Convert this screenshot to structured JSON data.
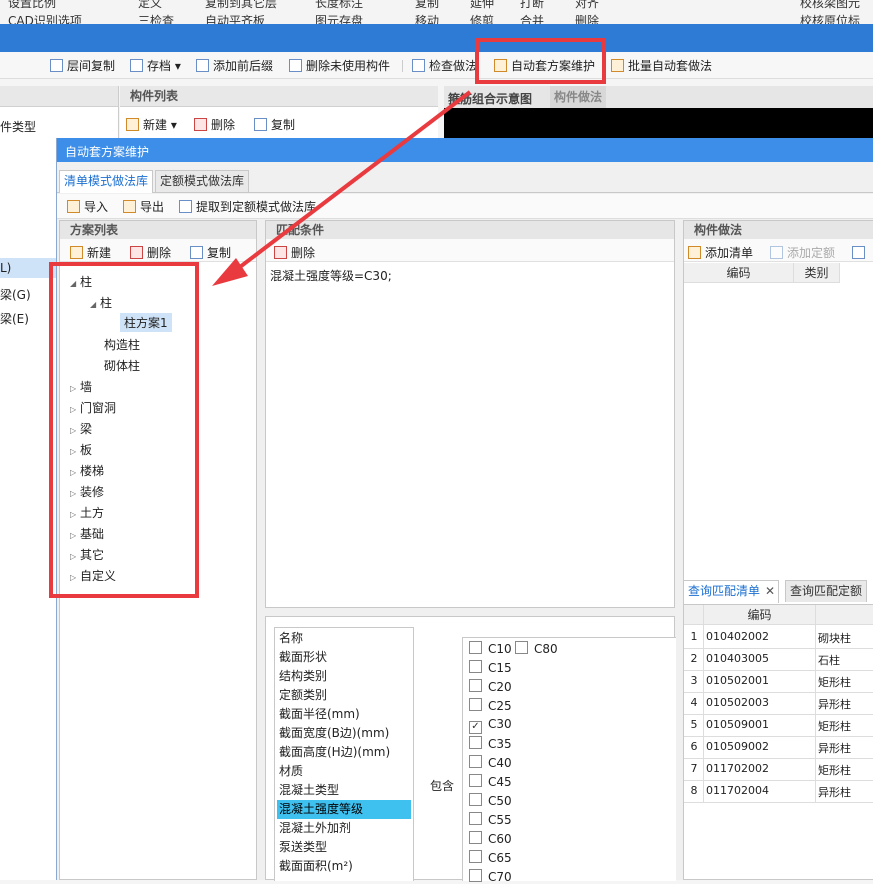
{
  "top_strip": [
    "设置比例",
    "CAD识别选项",
    "定义",
    "复制到其它层",
    "长度标注",
    "复制",
    "延伸",
    "打断",
    "对齐",
    "校核梁图元",
    "三检查",
    "自动平齐板",
    "图元存盘",
    "移动",
    "修剪",
    "合并",
    "删除",
    "校核原位标"
  ],
  "main_toolbar": {
    "floor_copy": "层间复制",
    "save": "存档",
    "add_prefix": "添加前后缀",
    "delete_unused": "删除未使用构件",
    "check_method": "检查做法",
    "auto_maint": "自动套方案维护",
    "batch_auto": "批量自动套做法"
  },
  "left_panel": {
    "type_label": "件类型",
    "items": [
      "L)",
      "梁(G)",
      "梁(E)"
    ]
  },
  "mid_panel": {
    "title": "构件列表",
    "new": "新建",
    "delete": "删除",
    "copy": "复制"
  },
  "right_tabs": [
    "箍筋组合示意图",
    "构件做法"
  ],
  "dialog": {
    "title": "自动套方案维护",
    "tabs": [
      "清单模式做法库",
      "定额模式做法库"
    ],
    "toolbar": {
      "import": "导入",
      "export": "导出",
      "extract": "提取到定额模式做法库"
    },
    "scheme": {
      "title": "方案列表",
      "new": "新建",
      "delete": "删除",
      "copy": "复制",
      "tree": {
        "root": "柱",
        "child": "柱",
        "leaf": "柱方案1",
        "sub1": "构造柱",
        "sub2": "砌体柱",
        "others": [
          "墙",
          "门窗洞",
          "梁",
          "板",
          "楼梯",
          "装修",
          "土方",
          "基础",
          "其它",
          "自定义"
        ]
      }
    },
    "condition": {
      "title": "匹配条件",
      "delete": "删除",
      "text": "混凝土强度等级=C30;"
    },
    "attributes": [
      "名称",
      "截面形状",
      "结构类别",
      "定额类别",
      "截面半径(mm)",
      "截面宽度(B边)(mm)",
      "截面高度(H边)(mm)",
      "材质",
      "混凝土类型",
      "混凝土强度等级",
      "混凝土外加剂",
      "泵送类型",
      "截面面积(m²)"
    ],
    "selected_attribute": "混凝土强度等级",
    "contain_label": "包含",
    "grades": [
      {
        "label": "C10",
        "checked": false
      },
      {
        "label": "C80",
        "checked": false
      },
      {
        "label": "C15",
        "checked": false
      },
      {
        "label": "C20",
        "checked": false
      },
      {
        "label": "C25",
        "checked": false
      },
      {
        "label": "C30",
        "checked": true
      },
      {
        "label": "C35",
        "checked": false
      },
      {
        "label": "C40",
        "checked": false
      },
      {
        "label": "C45",
        "checked": false
      },
      {
        "label": "C50",
        "checked": false
      },
      {
        "label": "C55",
        "checked": false
      },
      {
        "label": "C60",
        "checked": false
      },
      {
        "label": "C65",
        "checked": false
      },
      {
        "label": "C70",
        "checked": false
      }
    ],
    "method": {
      "title": "构件做法",
      "add_list": "添加清单",
      "add_quota": "添加定额",
      "col_code": "编码",
      "col_type": "类别"
    },
    "query": {
      "tab1": "查询匹配清单",
      "tab2": "查询匹配定额",
      "col_code": "编码",
      "rows": [
        {
          "n": "1",
          "code": "010402002",
          "type": "砌块柱"
        },
        {
          "n": "2",
          "code": "010403005",
          "type": "石柱"
        },
        {
          "n": "3",
          "code": "010502001",
          "type": "矩形柱"
        },
        {
          "n": "4",
          "code": "010502003",
          "type": "异形柱"
        },
        {
          "n": "5",
          "code": "010509001",
          "type": "矩形柱"
        },
        {
          "n": "6",
          "code": "010509002",
          "type": "异形柱"
        },
        {
          "n": "7",
          "code": "011702002",
          "type": "矩形柱"
        },
        {
          "n": "8",
          "code": "011702004",
          "type": "异形柱"
        }
      ]
    }
  },
  "colors": {
    "accent": "#2e7bd6",
    "highlight": "#e83a3f",
    "selected_row": "#3fc1f0"
  }
}
